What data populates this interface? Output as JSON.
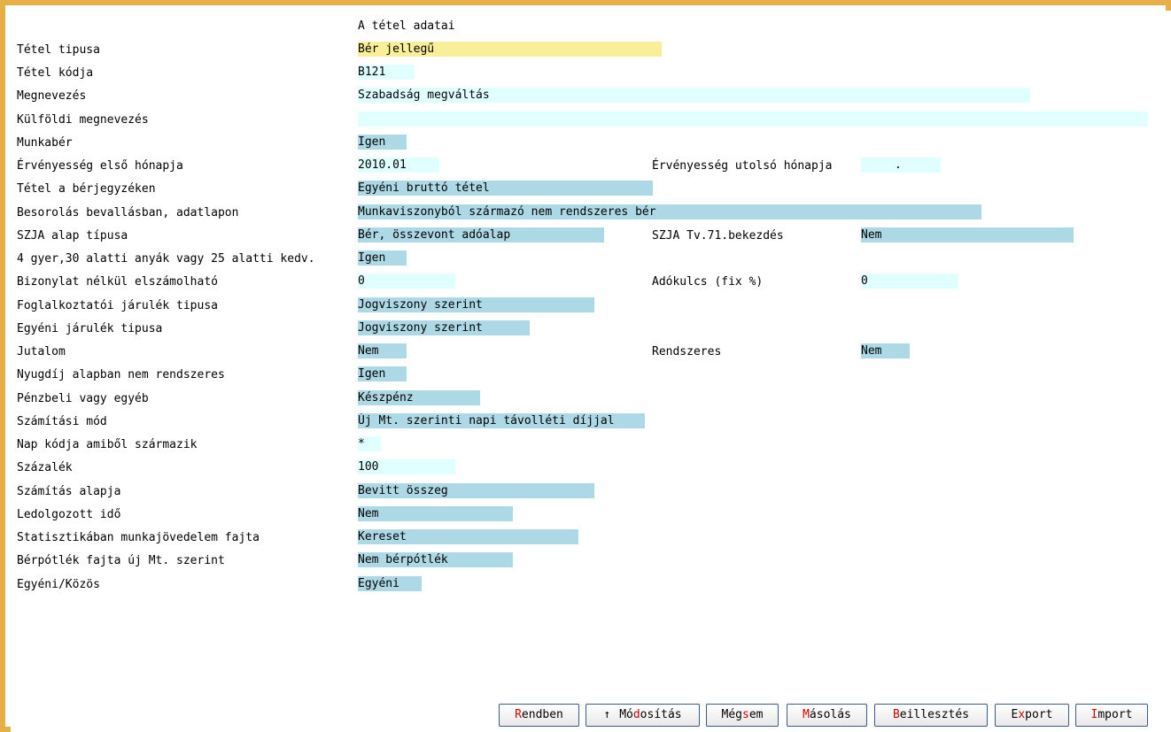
{
  "header": {
    "title": "A tétel adatai"
  },
  "rows": [
    {
      "label": "Tétel tipusa",
      "value": "Bér jellegű"
    },
    {
      "label": "Tétel kódja",
      "value": "B121"
    },
    {
      "label": "Megnevezés",
      "value": "Szabadság megváltás"
    },
    {
      "label": "Külföldi megnevezés",
      "value": ""
    },
    {
      "label": "Munkabér",
      "value": "Igen"
    },
    {
      "label": "Érvényesség első hónapja",
      "value": "2010.01"
    },
    {
      "label": "Tétel a bérjegyzéken",
      "value": "Egyéni bruttó tétel"
    },
    {
      "label": "Besorolás bevallásban, adatlapon",
      "value": "Munkaviszonyból származó nem rendszeres bér"
    },
    {
      "label": "SZJA alap típusa",
      "value": "Bér, összevont adóalap"
    },
    {
      "label": "4 gyer,30 alatti anyák vagy 25 alatti kedv.",
      "value": "Igen"
    },
    {
      "label": "Bizonylat nélkül elszámolható",
      "value": "0"
    },
    {
      "label": "Foglalkoztatói járulék tipusa",
      "value": "Jogviszony szerint"
    },
    {
      "label": "Egyéni járulék tipusa",
      "value": "Jogviszony szerint"
    },
    {
      "label": "Jutalom",
      "value": "Nem"
    },
    {
      "label": "Nyugdíj alapban nem rendszeres",
      "value": "Igen"
    },
    {
      "label": "Pénzbeli vagy egyéb",
      "value": "Készpénz"
    },
    {
      "label": "Számítási mód",
      "value": "Új Mt. szerinti napi távolléti díjjal"
    },
    {
      "label": "Nap kódja amiből származik",
      "value": "*"
    },
    {
      "label": "Százalék",
      "value": "100"
    },
    {
      "label": "Számítás alapja",
      "value": "Bevitt összeg"
    },
    {
      "label": "Ledolgozott idő",
      "value": "Nem"
    },
    {
      "label": "Statisztikában munkajövedelem fajta",
      "value": "Kereset"
    },
    {
      "label": "Bérpótlék fajta új Mt. szerint",
      "value": "Nem bérpótlék"
    },
    {
      "label": "Egyéni/Közös",
      "value": "Egyéni"
    }
  ],
  "right": {
    "ervenyesseg_utolso": {
      "label": "Érvényesség utolsó hónapja",
      "value": "."
    },
    "szja_tv71": {
      "label": "SZJA Tv.71.bekezdés",
      "value": "Nem"
    },
    "adokulcs": {
      "label": "Adókulcs (fix %)",
      "value": "0"
    },
    "rendszeres": {
      "label": "Rendszeres",
      "value": "Nem"
    }
  },
  "buttons": {
    "rendben": {
      "hot": "R",
      "rest": "endben"
    },
    "modositas": {
      "arrow": "↑",
      "pre": "Mó",
      "hot": "d",
      "rest": "osítás"
    },
    "megsem": {
      "pre": "Még",
      "hot": "s",
      "rest": "em"
    },
    "masolas": {
      "hot": "M",
      "rest": "ásolás"
    },
    "beillesztes": {
      "hot": "B",
      "rest": "eillesztés"
    },
    "export": {
      "pre": "E",
      "hot": "x",
      "rest": "port"
    },
    "import": {
      "hot": "I",
      "rest": "mport"
    }
  }
}
